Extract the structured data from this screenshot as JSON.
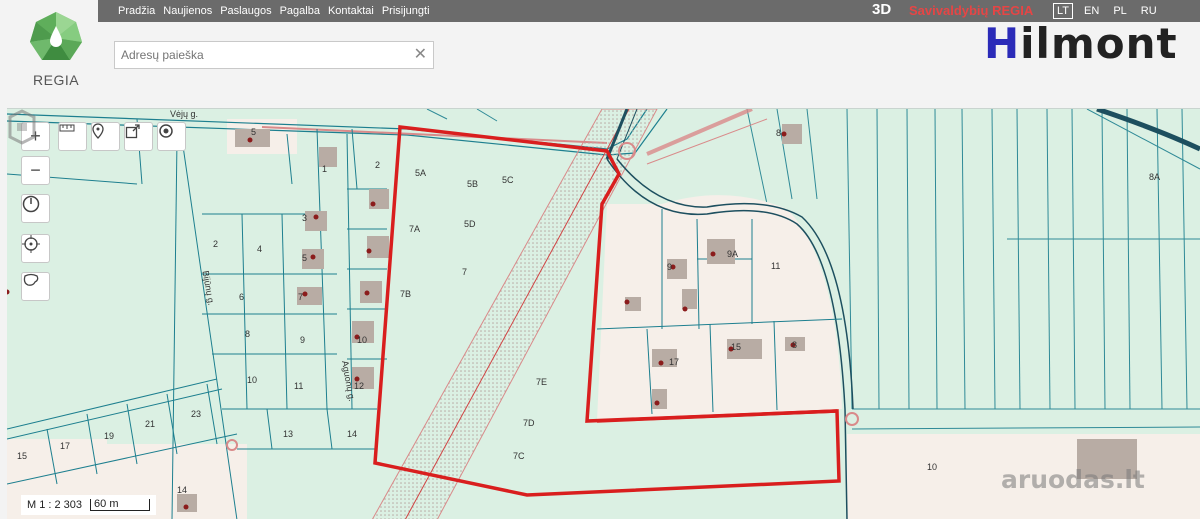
{
  "nav": {
    "items": [
      "Pradžia",
      "Naujienos",
      "Paslaugos",
      "Pagalba",
      "Kontaktai",
      "Prisijungti"
    ],
    "view_3d": "3D",
    "brand": "Savivaldybių REGIA",
    "languages": [
      {
        "code": "LT",
        "active": true
      },
      {
        "code": "EN",
        "active": false
      },
      {
        "code": "PL",
        "active": false
      },
      {
        "code": "RU",
        "active": false
      }
    ]
  },
  "logo": {
    "text": "REGIA",
    "icon": "regia-logo-icon"
  },
  "search": {
    "placeholder": "Adresų paieška",
    "value": ""
  },
  "watermark": {
    "hilmont_first": "H",
    "hilmont_rest": "ilmont",
    "aruodas": "aruodas.lt"
  },
  "map": {
    "scale_text": "M 1 : 2 303",
    "scale_bar_text": "60 m",
    "street_labels": [
      "Vėjų g.",
      "Bijūnų g.",
      "Aguonų g."
    ],
    "parcel_labels": {
      "a5": "5",
      "a1": "1",
      "a2": "2",
      "a3": "3",
      "a4": "4",
      "a2b": "2",
      "a4b": "4",
      "a5b": "5",
      "a6": "6",
      "a7": "7",
      "a8": "8",
      "a9": "9",
      "a10": "10",
      "a10b": "10",
      "a11": "11",
      "a12": "12",
      "a13": "13",
      "a14": "14",
      "a14b": "14",
      "a15": "15",
      "a17": "17",
      "a19": "19",
      "a21": "21",
      "a23": "23",
      "p5a": "5A",
      "p5b": "5B",
      "p5c": "5C",
      "p5d": "5D",
      "p7a": "7A",
      "p7": "7",
      "p7b": "7B",
      "p7e": "7E",
      "p7d": "7D",
      "p7c": "7C",
      "p8": "8",
      "p8a": "8A",
      "p9": "9",
      "p9a": "9A",
      "p11": "11",
      "p15": "15",
      "p17": "17",
      "p8b": "8",
      "p10": "10"
    },
    "tools": {
      "zoom_in": "plus-icon",
      "zoom_out": "minus-icon",
      "measure": "ruler-icon",
      "marker": "map-marker-icon",
      "share": "share-icon",
      "layers": "target-icon",
      "history": "clock-icon",
      "locate": "crosshair-icon",
      "region": "lasso-icon"
    },
    "colors": {
      "land": "#dbf0e3",
      "built": "#f6efe9",
      "parcel_line": "#1d7f8f",
      "highlight": "#d91e1e",
      "road_edge": "#d98a8a",
      "building": "#b8aca4",
      "point": "#8b1c1c"
    }
  }
}
